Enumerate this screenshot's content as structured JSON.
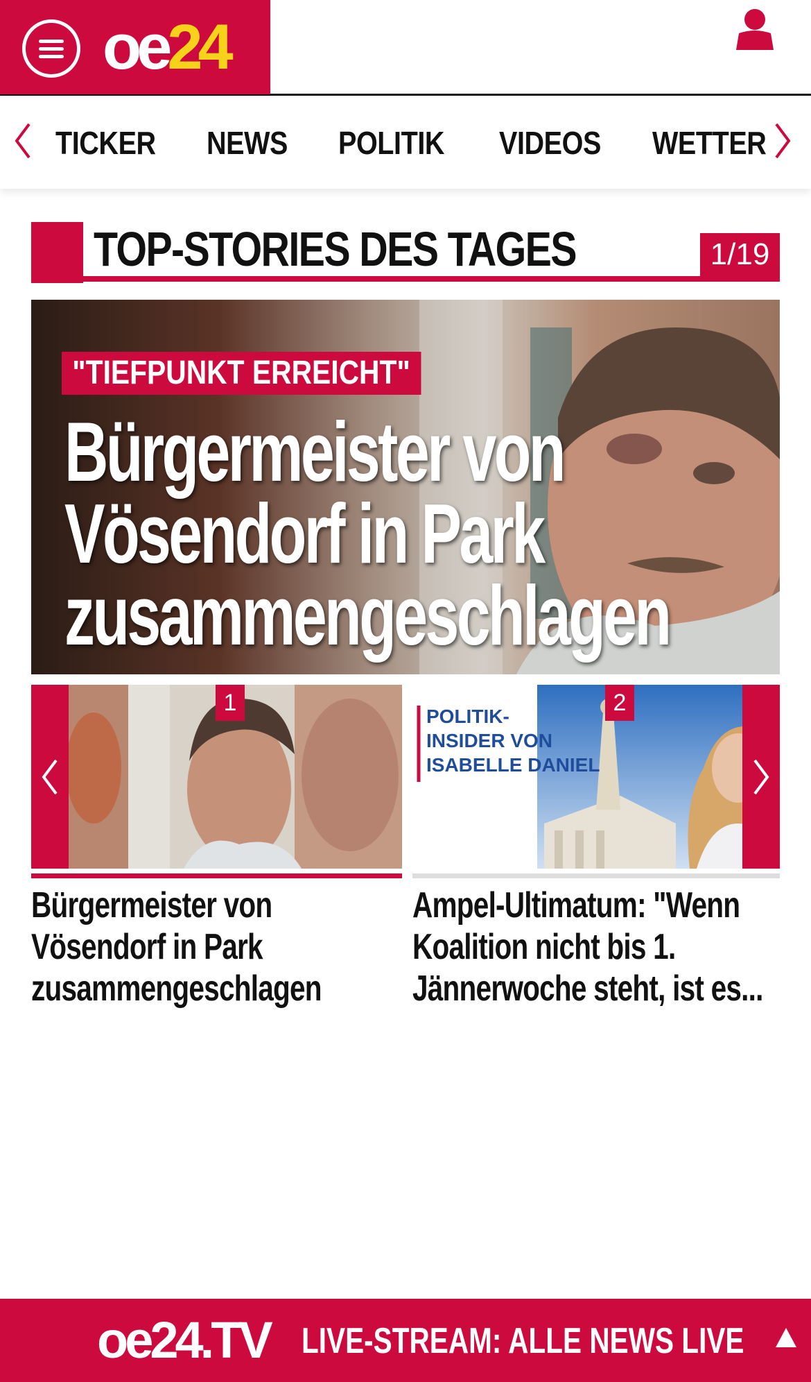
{
  "header": {
    "logo_oe": "oe",
    "logo_num": "24"
  },
  "nav": {
    "items": [
      {
        "label": "TICKER"
      },
      {
        "label": "NEWS"
      },
      {
        "label": "POLITIK"
      },
      {
        "label": "VIDEOS"
      },
      {
        "label": "WETTER"
      }
    ]
  },
  "section": {
    "title": "TOP-STORIES DES TAGES",
    "counter": "1/19"
  },
  "hero": {
    "kicker": "\"TIEFPUNKT ERREICHT\"",
    "title_line1": "Bürgermeister von",
    "title_line2": "Vösendorf in Park",
    "title_line3": "zusammengeschlagen"
  },
  "cards": [
    {
      "number": "1",
      "title_line1": "Bürgermeister von",
      "title_line2": "Vösendorf in Park",
      "title_line3": "zusammengeschlagen"
    },
    {
      "number": "2",
      "image_label_line1": "POLITIK-",
      "image_label_line2": "INSIDER VON",
      "image_label_line3": "ISABELLE DANIEL",
      "title_line1": "Ampel-Ultimatum: \"Wenn",
      "title_line2": "Koalition nicht bis 1.",
      "title_line3": "Jännerwoche steht, ist es..."
    }
  ],
  "footer": {
    "logo": "oe24.TV",
    "text": "LIVE-STREAM:  ALLE NEWS LIVE"
  },
  "colors": {
    "brand_red": "#cc0a3e",
    "logo_yellow": "#f7d21a"
  },
  "icons": {
    "menu": "menu-icon",
    "user": "user-icon",
    "nav_prev": "chevron-left-icon",
    "nav_next": "chevron-right-icon",
    "scroll_top": "triangle-up-icon"
  }
}
